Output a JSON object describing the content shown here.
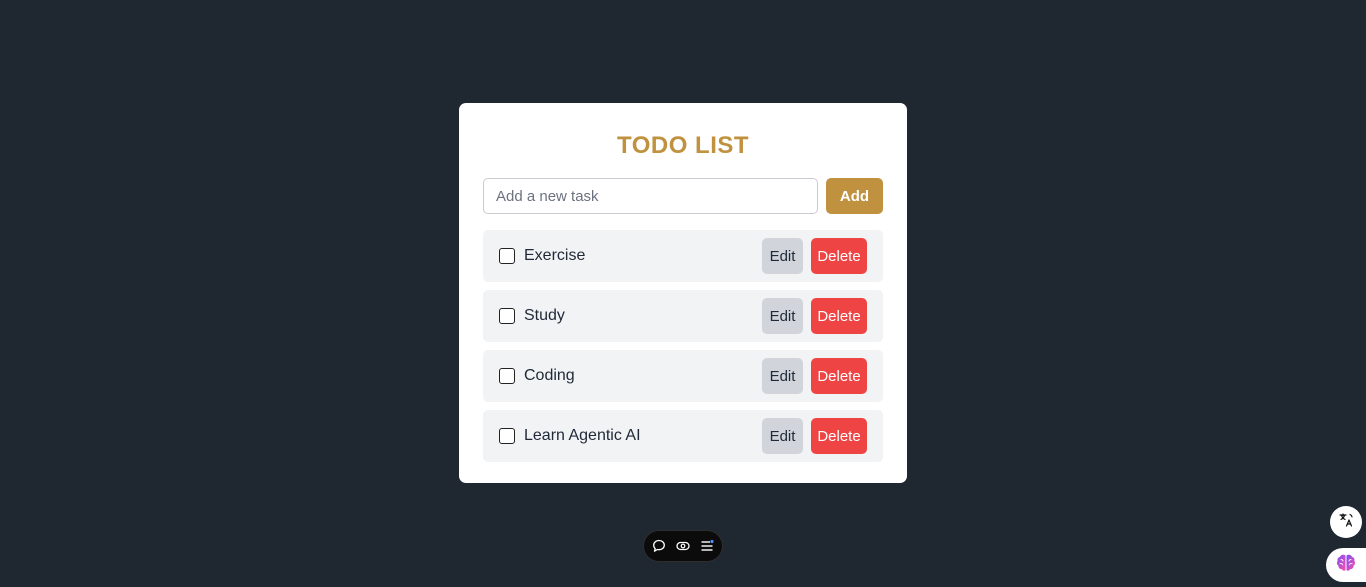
{
  "app": {
    "title": "TODO LIST"
  },
  "input": {
    "placeholder": "Add a new task",
    "value": ""
  },
  "buttons": {
    "add": "Add",
    "edit": "Edit",
    "delete": "Delete"
  },
  "tasks": [
    {
      "label": "Exercise",
      "done": false
    },
    {
      "label": "Study",
      "done": false
    },
    {
      "label": "Coding",
      "done": false
    },
    {
      "label": "Learn Agentic AI",
      "done": false
    }
  ],
  "toolbar": {
    "icons": [
      "chat-icon",
      "eye-icon",
      "list-icon"
    ]
  },
  "side_buttons": {
    "icons": [
      "translate-icon",
      "brain-icon"
    ]
  },
  "colors": {
    "background": "#1f2730",
    "accent": "#c0923f",
    "danger": "#ef4444",
    "task_bg": "#f2f3f5",
    "edit_bg": "#d1d5db"
  }
}
